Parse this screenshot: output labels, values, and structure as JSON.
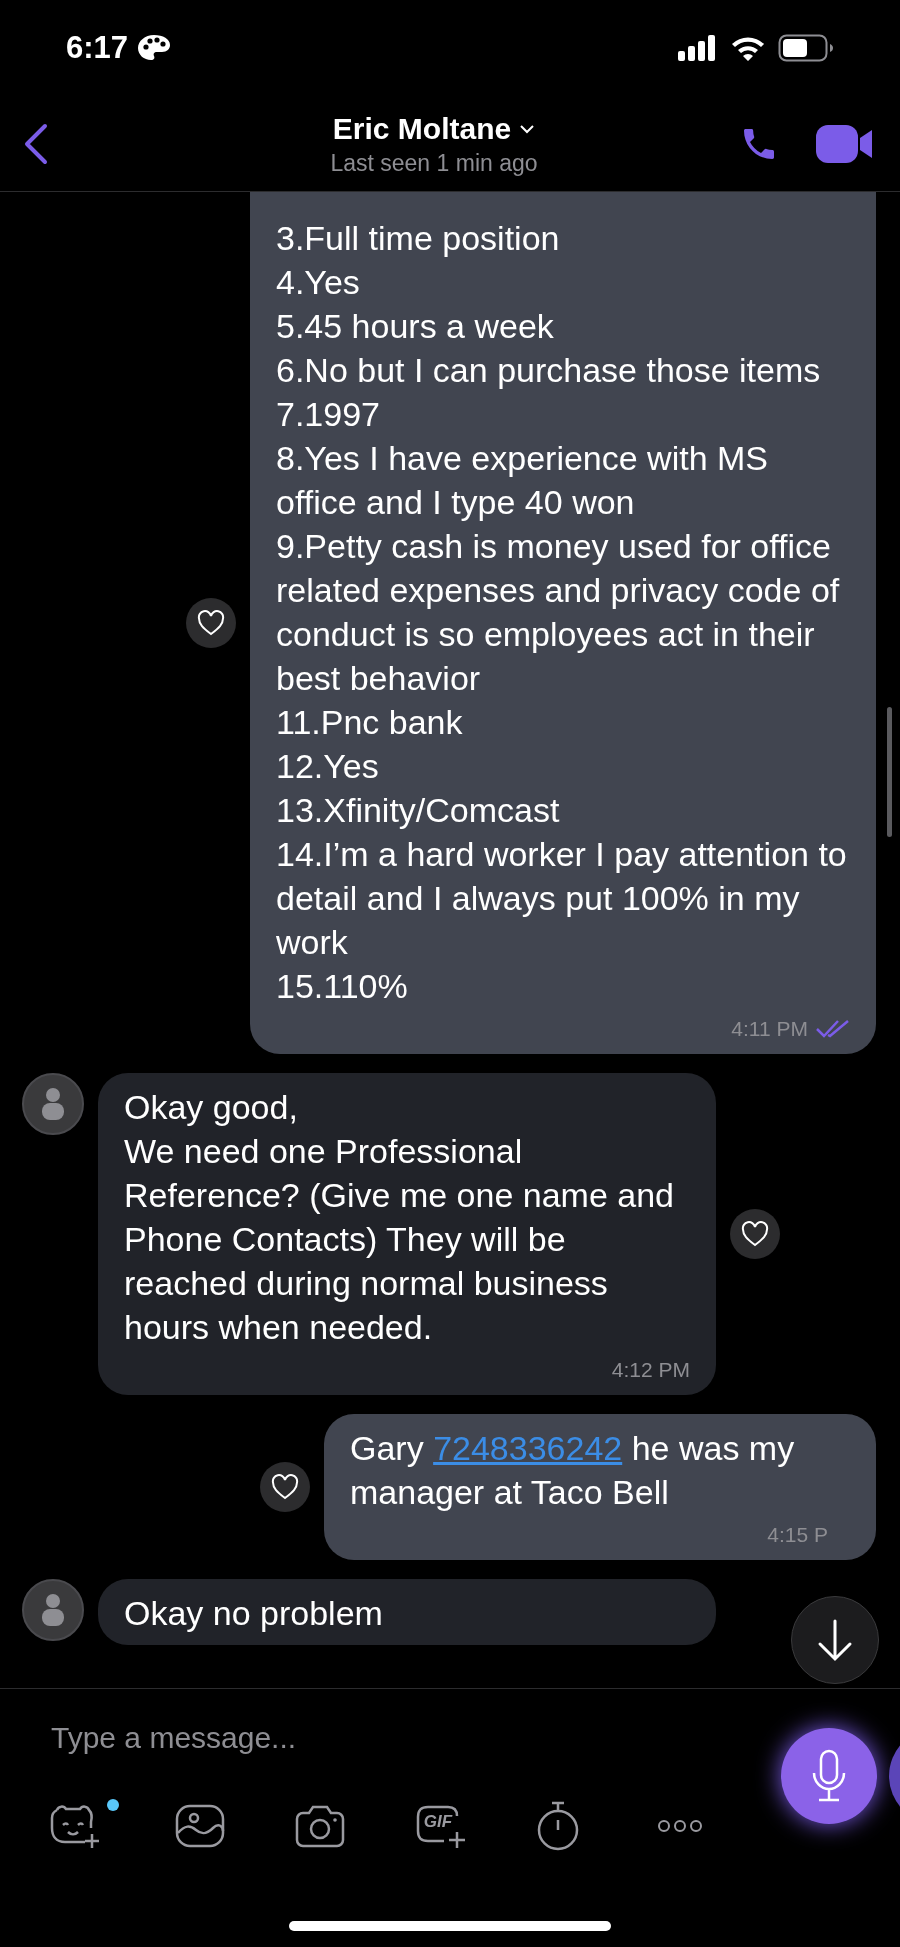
{
  "status_bar": {
    "time": "6:17"
  },
  "header": {
    "title": "Eric Moltane",
    "subtitle": "Last seen 1 min ago"
  },
  "messages": [
    {
      "kind": "outgoing",
      "liked": false,
      "lines": [
        "3.Full time position",
        "4.Yes",
        "5.45 hours a week",
        "6.No but I can purchase those items",
        "7.1997",
        "8.Yes I have experience with MS office and I type 40 won",
        "9.Petty cash is money used for office related expenses and privacy code of conduct is so employees act in their best behavior",
        "11.Pnc bank",
        "12.Yes",
        "13.Xfinity/Comcast",
        "14.I’m a hard worker I pay attention to detail and I always put 100% in my work",
        "15.110%"
      ],
      "time": "4:11 PM",
      "read": true
    },
    {
      "kind": "incoming",
      "liked": false,
      "lines": [
        "Okay good,",
        "We need one Professional Reference? (Give me one name and Phone Contacts) They will be reached during normal business hours when needed."
      ],
      "time": "4:12 PM"
    },
    {
      "kind": "outgoing",
      "liked": false,
      "parts": [
        {
          "kind": "text",
          "text": "Gary "
        },
        {
          "kind": "link",
          "text": "7248336242"
        },
        {
          "kind": "text",
          "text": " he was my manager at Taco Bell"
        }
      ],
      "time": "4:15 P",
      "read": false
    },
    {
      "kind": "incoming",
      "lines": [
        "Okay no problem"
      ]
    }
  ],
  "composer": {
    "placeholder": "Type a message...",
    "sticker_badge": true,
    "gif_label": "GIF"
  }
}
